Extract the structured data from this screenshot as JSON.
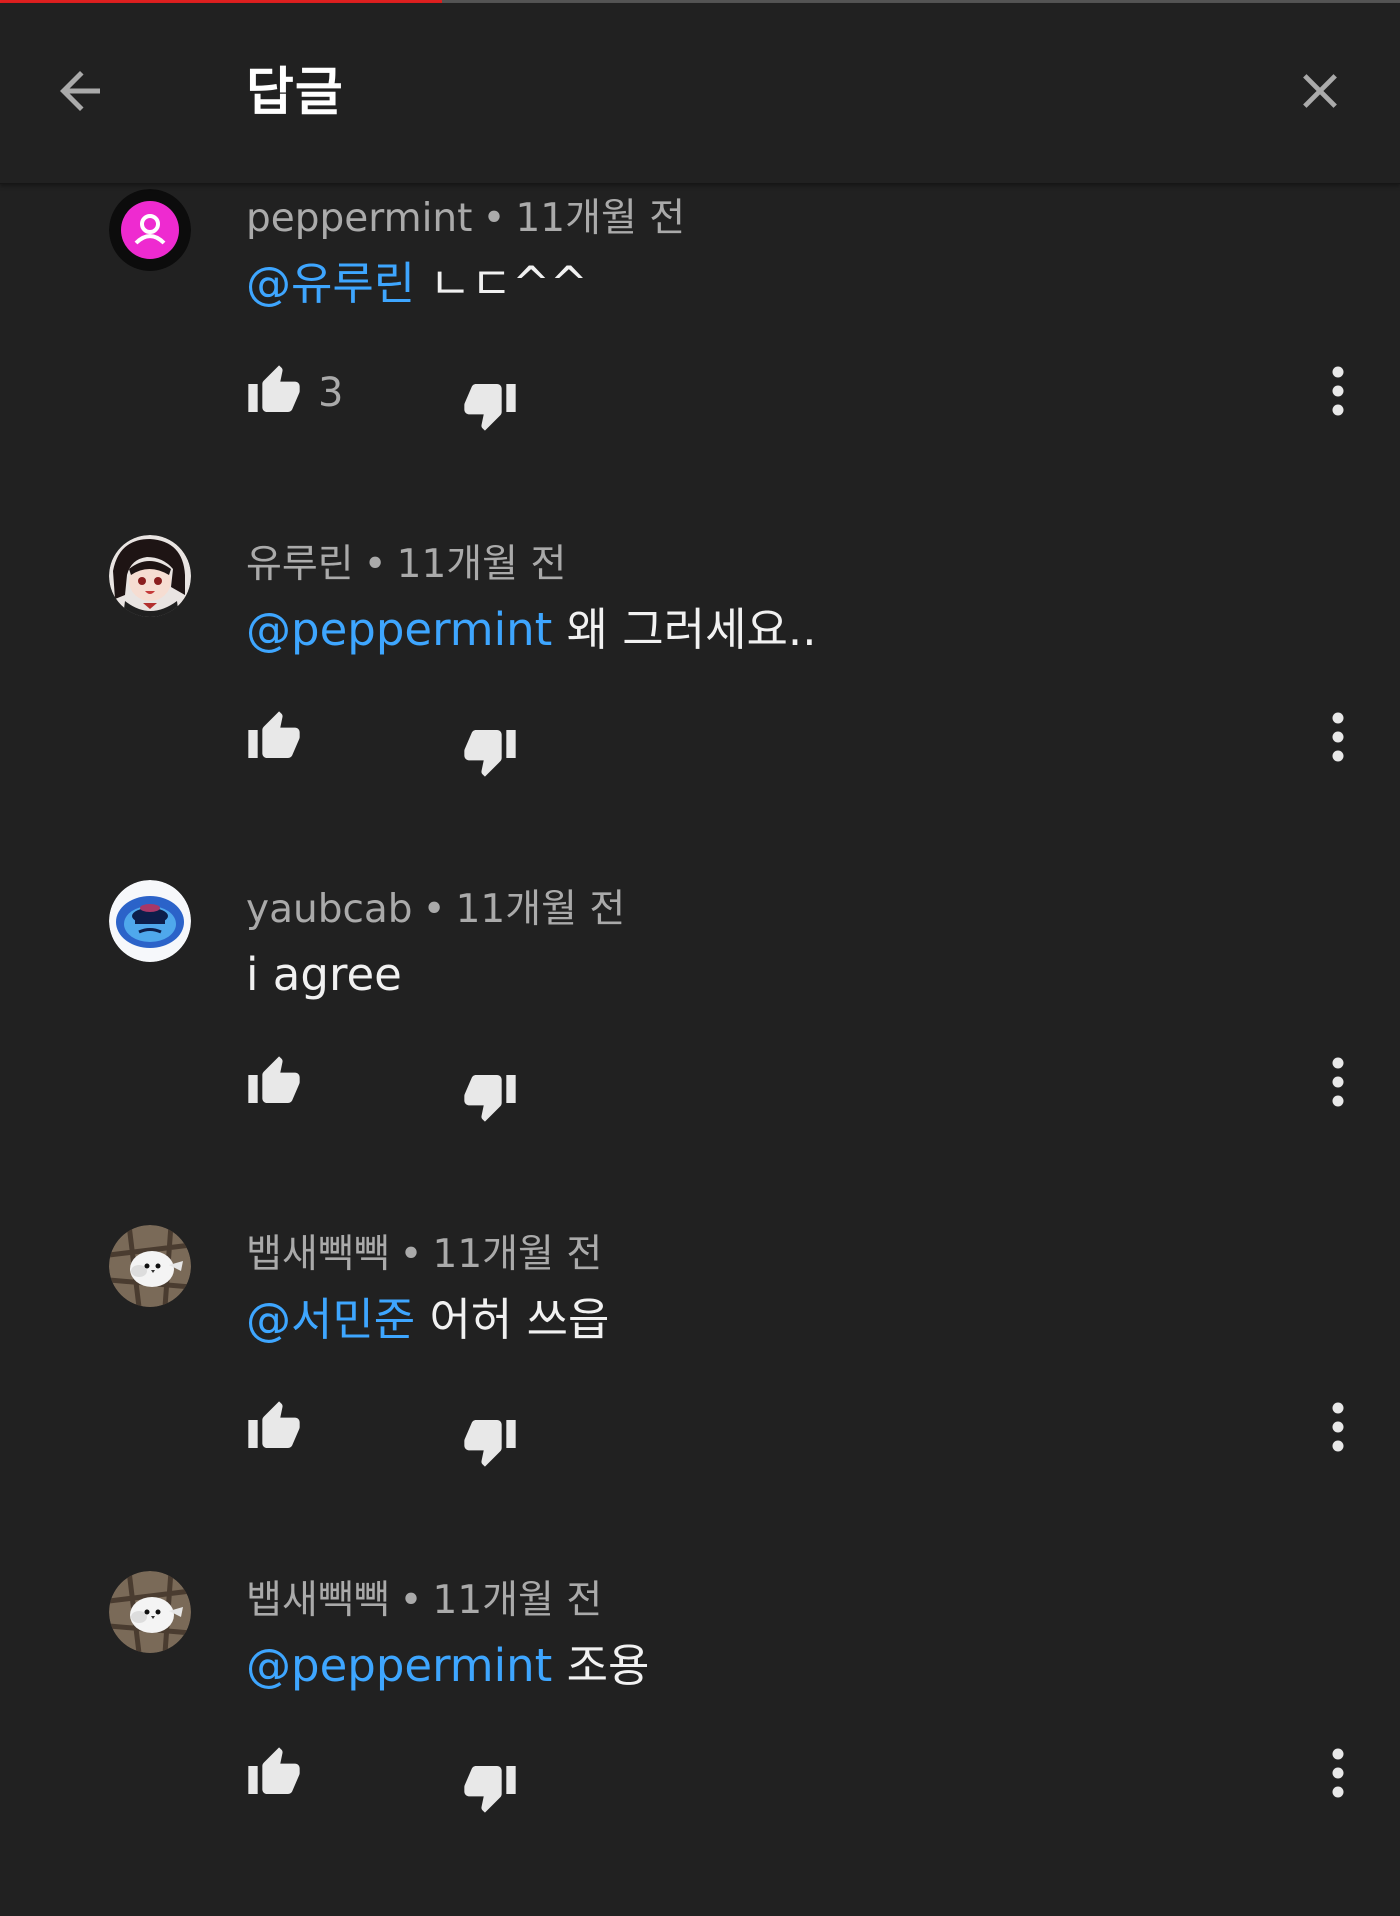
{
  "header": {
    "title": "답글",
    "progress_fraction": 0.316
  },
  "colors": {
    "background": "#212121",
    "mention": "#3ea6ff",
    "meta": "#aaaaaa",
    "progress": "#e02020"
  },
  "icons": {
    "back": "arrow-left-icon",
    "close": "close-icon",
    "like": "thumb-up-icon",
    "dislike": "thumb-down-icon",
    "more": "more-vert-icon"
  },
  "comments": [
    {
      "author": "peppermint",
      "separator": "•",
      "time": "11개월 전",
      "mention": "@유루린",
      "text": " ㄴㄷ^^",
      "like_count": "3",
      "avatar": "pink-person-avatar"
    },
    {
      "author": "유루린",
      "separator": "•",
      "time": "11개월 전",
      "mention": "@peppermint",
      "text": " 왜 그러세요..",
      "like_count": "",
      "avatar": "anime-girl-avatar"
    },
    {
      "author": "yaubcab",
      "separator": "•",
      "time": "11개월 전",
      "mention": "",
      "text": "i agree",
      "like_count": "",
      "avatar": "blue-face-avatar"
    },
    {
      "author": "뱁새빽빽",
      "separator": "•",
      "time": "11개월 전",
      "mention": "@서민준",
      "text": " 어허 쓰읍",
      "like_count": "",
      "avatar": "white-bird-avatar"
    },
    {
      "author": "뱁새빽빽",
      "separator": "•",
      "time": "11개월 전",
      "mention": "@peppermint",
      "text": " 조용",
      "like_count": "",
      "avatar": "white-bird-avatar"
    }
  ]
}
